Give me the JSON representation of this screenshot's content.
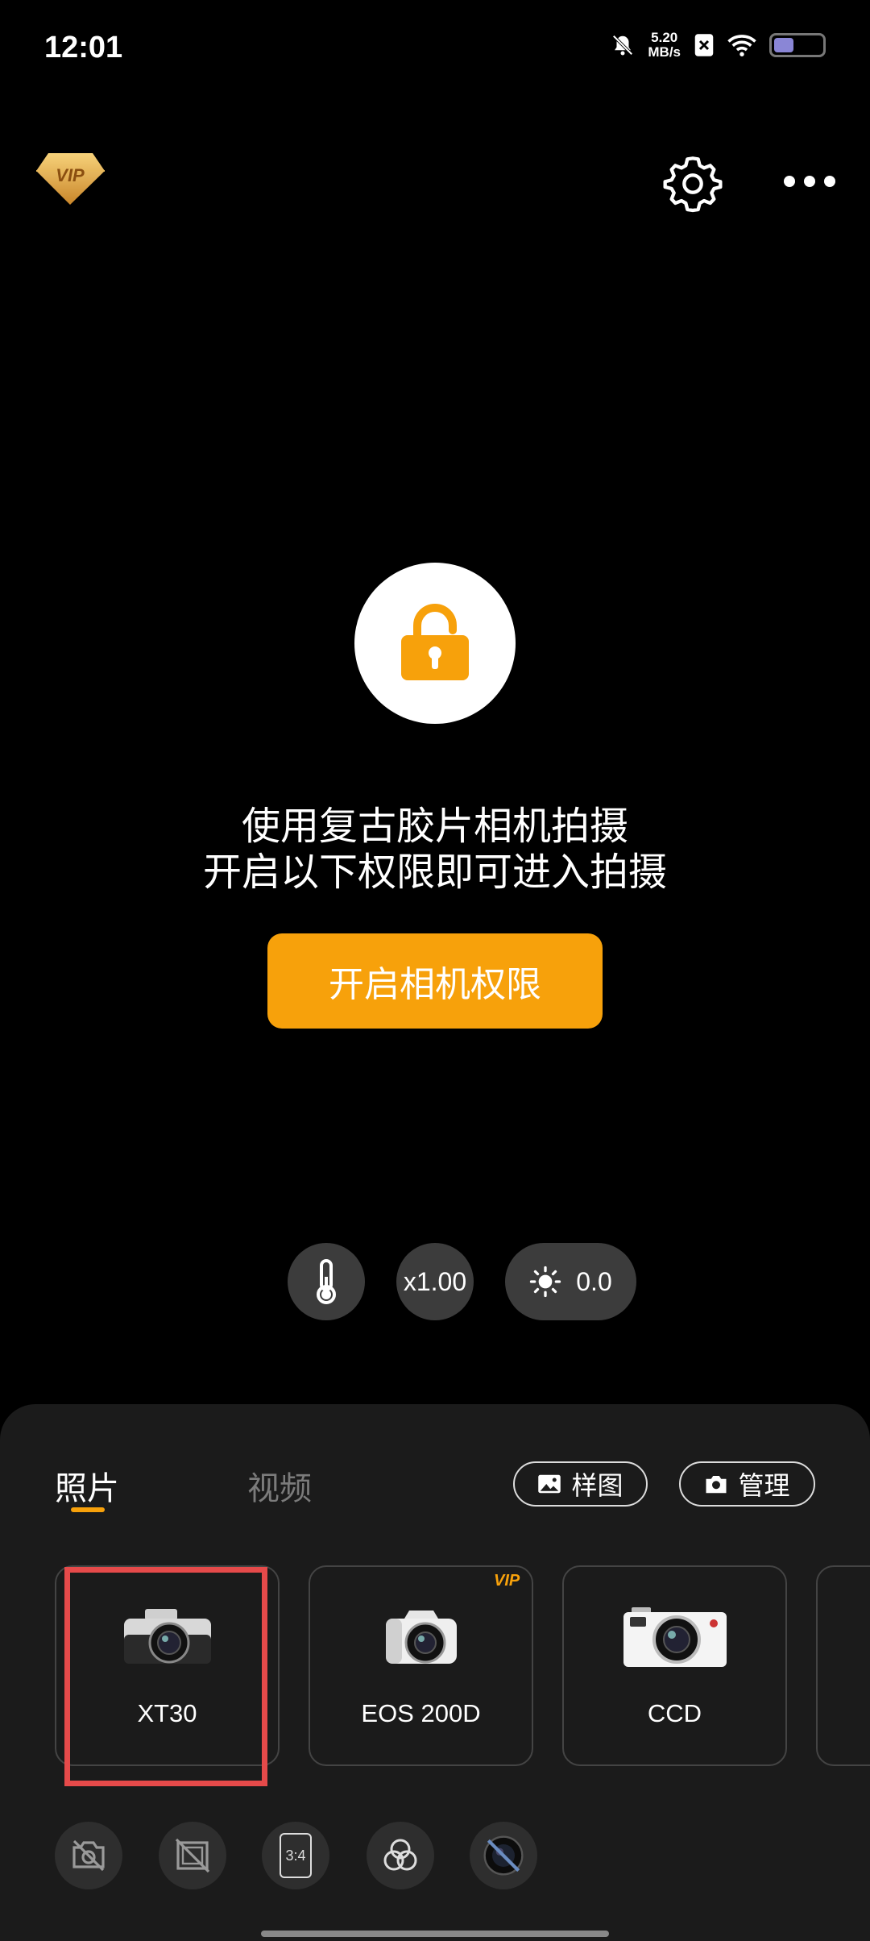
{
  "status_bar": {
    "time": "12:01",
    "speed_value": "5.20",
    "speed_unit": "MB/s",
    "icons": [
      "bell-muted-icon",
      "sim-x-icon",
      "wifi-icon",
      "battery-icon"
    ]
  },
  "top": {
    "vip_label": "VIP",
    "icons": [
      "vip-diamond-icon",
      "settings-gear-icon",
      "more-dots-icon"
    ]
  },
  "permission": {
    "line1": "使用复古胶片相机拍摄",
    "line2": "开启以下权限即可进入拍摄",
    "button_label": "开启相机权限"
  },
  "controls": {
    "zoom": "x1.00",
    "exposure": "0.0"
  },
  "panel": {
    "tabs": [
      {
        "label": "照片",
        "active": true
      },
      {
        "label": "视频",
        "active": false
      }
    ],
    "sample_label": "样图",
    "manage_label": "管理",
    "cameras": [
      {
        "label": "XT30"
      },
      {
        "label": "EOS 200D",
        "badge": "VIP"
      },
      {
        "label": "CCD"
      }
    ],
    "tools": [
      "camera-off-icon",
      "frame-off-icon",
      "aspect-ratio-icon",
      "filter-circles-icon",
      "lens-off-icon"
    ],
    "aspect_label": "3:4"
  },
  "colors": {
    "accent": "#f7a10b",
    "highlight": "#e64a4a",
    "panel_bg": "#1b1b1b"
  }
}
